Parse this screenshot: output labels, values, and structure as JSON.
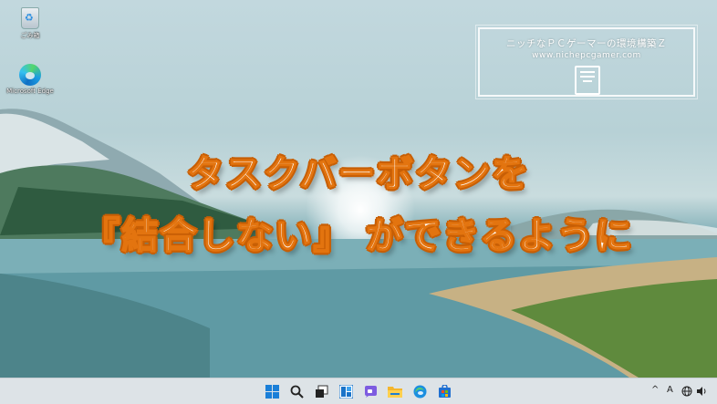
{
  "desktop": {
    "icons": [
      {
        "label": "ごみ箱",
        "icon": "recycle-bin-icon"
      },
      {
        "label": "Microsoft Edge",
        "icon": "edge-icon"
      }
    ]
  },
  "brand": {
    "title": "ニッチなＰＣゲーマーの環境構築Ｚ",
    "url": "www.nichepcgamer.com",
    "icon": "pc-tower-icon"
  },
  "headline": {
    "line1": "タスクバーボタンを",
    "line2": "『結合しない』 ができるように"
  },
  "taskbar": {
    "apps": [
      "start-icon",
      "search-icon",
      "task-view-icon",
      "widgets-icon",
      "chat-icon",
      "file-explorer-icon",
      "edge-icon",
      "store-icon"
    ],
    "tray": {
      "chevron": "^",
      "ime": "A"
    }
  },
  "colors": {
    "headline_fill": "#ffffff",
    "headline_outline": "#e3740f",
    "taskbar_bg": "#dde3e7"
  }
}
